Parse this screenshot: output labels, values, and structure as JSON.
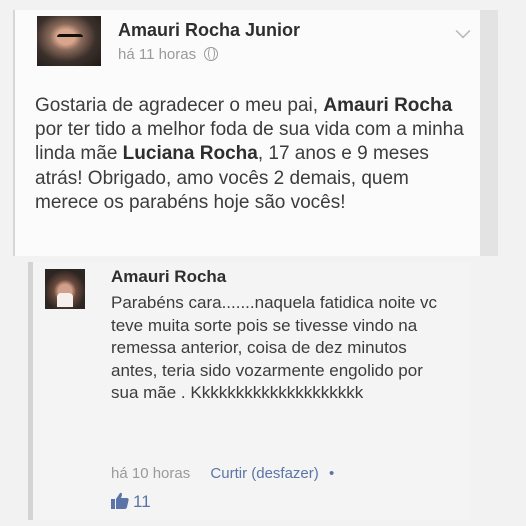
{
  "post": {
    "author": "Amauri Rocha Junior",
    "time": "há 11 horas",
    "icons": {
      "privacy": "globe-icon",
      "menu": "chevron-down-icon"
    },
    "text": {
      "p1": "Gostaria de agradecer o meu pai, ",
      "name1": "Amauri Rocha",
      "p2": " por ter tido a melhor foda de sua vida com a minha linda mãe ",
      "name2": "Luciana Rocha",
      "p3": ", 17 anos e 9 meses atrás! Obrigado, amo vocês 2 demais, quem merece os parabéns hoje são vocês!"
    }
  },
  "comment": {
    "author": "Amauri Rocha",
    "text": "Parabéns cara.......naquela fatidica noite vc teve muita sorte pois se tivesse vindo na remessa anterior, coisa de dez minutos antes, teria sido vozarmente engolido por sua mãe . Kkkkkkkkkkkkkkkkkkkk",
    "time": "há 10 horas",
    "like_label": "Curtir (desfazer)",
    "separator": "•",
    "like_count": "11",
    "icons": {
      "like": "thumbs-up-icon"
    },
    "colors": {
      "link": "#5b74a8"
    }
  }
}
